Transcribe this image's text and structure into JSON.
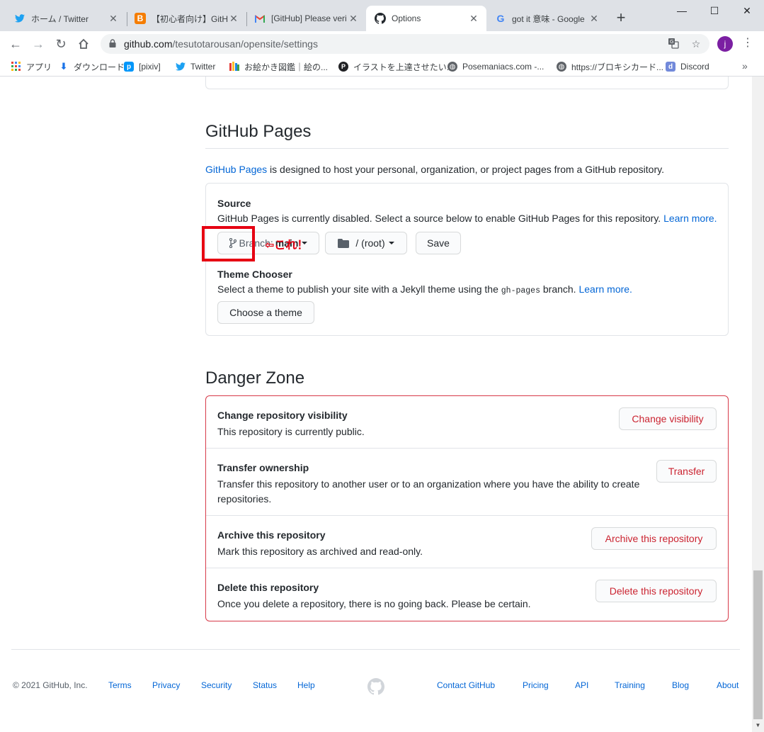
{
  "browser": {
    "tabs": [
      {
        "title": "ホーム / Twitter",
        "icon": "twitter-icon",
        "active": false
      },
      {
        "title": "【初心者向け】GitHub",
        "icon": "blogger-icon",
        "active": false
      },
      {
        "title": "[GitHub] Please veri",
        "icon": "gmail-icon",
        "active": false
      },
      {
        "title": "Options",
        "icon": "github-icon",
        "active": true
      },
      {
        "title": "got it 意味 - Google",
        "icon": "google-icon",
        "active": false
      }
    ],
    "close_glyph": "✕",
    "new_tab_glyph": "+",
    "window_controls": {
      "minimize": "—",
      "maximize": "☐",
      "close": "✕"
    },
    "url_host": "github.com",
    "url_path": "/tesutotarousan/opensite/settings",
    "profile_initial": "j",
    "bookmarks": [
      {
        "label": "アプリ",
        "icon": "apps-grid-icon"
      },
      {
        "label": "ダウンロード",
        "icon": "download-icon"
      },
      {
        "label": "[pixiv]",
        "icon": "pixiv-icon"
      },
      {
        "label": "Twitter",
        "icon": "twitter-icon"
      },
      {
        "label": "お絵かき図鑑｜絵の...",
        "icon": "oekaki-icon"
      },
      {
        "label": "イラストを上達させたい...",
        "icon": "pin-icon"
      },
      {
        "label": "Posemaniacs.com -...",
        "icon": "globe-icon"
      },
      {
        "label": "https://ブロキシカード...",
        "icon": "globe-icon"
      },
      {
        "label": "Discord",
        "icon": "discord-icon"
      }
    ],
    "bookmarks_more": "»"
  },
  "pages": {
    "heading": "GitHub Pages",
    "desc_link": "GitHub Pages",
    "desc_rest": " is designed to host your personal, organization, or project pages from a GitHub repository.",
    "source_label": "Source",
    "source_note": "GitHub Pages is currently disabled. Select a source below to enable GitHub Pages for this repository.",
    "learn_more": "Learn more.",
    "branch_prefix": "Branch: ",
    "branch_value": "main",
    "folder_value": "/ (root)",
    "save_label": "Save",
    "annotation": "⇦これ！",
    "theme_label": "Theme Chooser",
    "theme_note_before": "Select a theme to publish your site with a Jekyll theme using the ",
    "theme_code": "gh-pages",
    "theme_note_after": " branch.",
    "choose_theme_label": "Choose a theme"
  },
  "danger": {
    "heading": "Danger Zone",
    "rows": [
      {
        "title": "Change repository visibility",
        "desc": "This repository is currently public.",
        "button": "Change visibility"
      },
      {
        "title": "Transfer ownership",
        "desc": "Transfer this repository to another user or to an organization where you have the ability to create repositories.",
        "button": "Transfer"
      },
      {
        "title": "Archive this repository",
        "desc": "Mark this repository as archived and read-only.",
        "button": "Archive this repository"
      },
      {
        "title": "Delete this repository",
        "desc": "Once you delete a repository, there is no going back. Please be certain.",
        "button": "Delete this repository"
      }
    ]
  },
  "footer": {
    "copyright": "© 2021 GitHub, Inc.",
    "left_links": [
      "Terms",
      "Privacy",
      "Security",
      "Status",
      "Help"
    ],
    "right_links": [
      "Contact GitHub",
      "Pricing",
      "API",
      "Training",
      "Blog",
      "About"
    ]
  },
  "colors": {
    "link": "#0366d6",
    "danger": "#d73a49",
    "annotation": "#e60012"
  }
}
